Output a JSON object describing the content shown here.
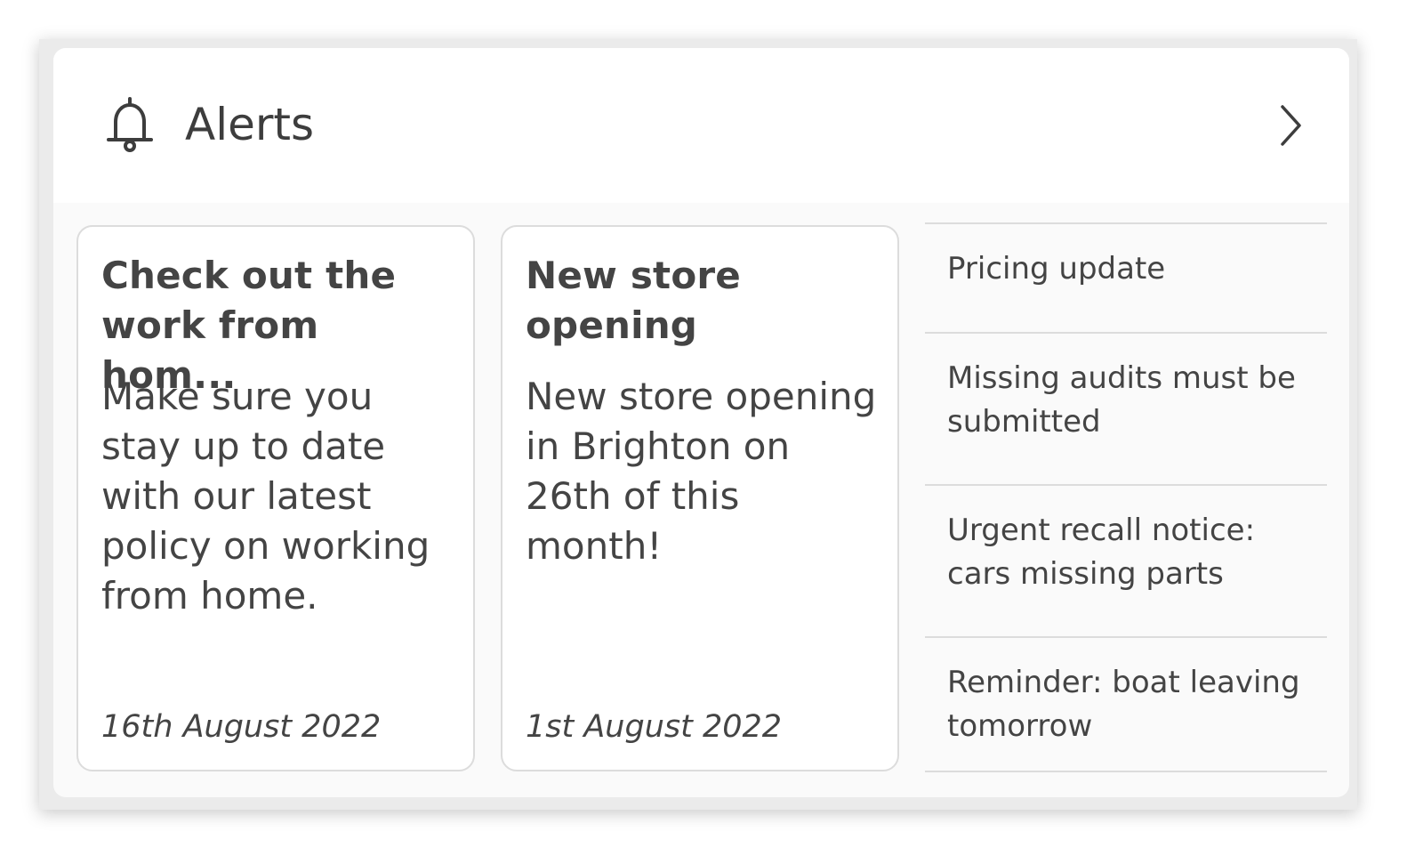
{
  "widget": {
    "title": "Alerts",
    "icons": {
      "header": "bell-icon",
      "navigate": "chevron-right-icon"
    },
    "colors": {
      "text": "#3d3d3d",
      "border": "#dcdcdc",
      "panel": "#fafafa"
    }
  },
  "featured": [
    {
      "title": "Check out the work from hom...",
      "body": "Make sure you stay up to date with our latest policy on working from home.",
      "date": "16th August 2022"
    },
    {
      "title": "New store opening",
      "body": "New store opening in Brighton on 26th of this month!",
      "date": "1st August 2022"
    }
  ],
  "list": [
    {
      "label": "Pricing update"
    },
    {
      "label": "Missing audits must be submitted"
    },
    {
      "label": "Urgent recall notice: cars missing parts"
    },
    {
      "label": "Reminder: boat leaving tomorrow"
    }
  ]
}
